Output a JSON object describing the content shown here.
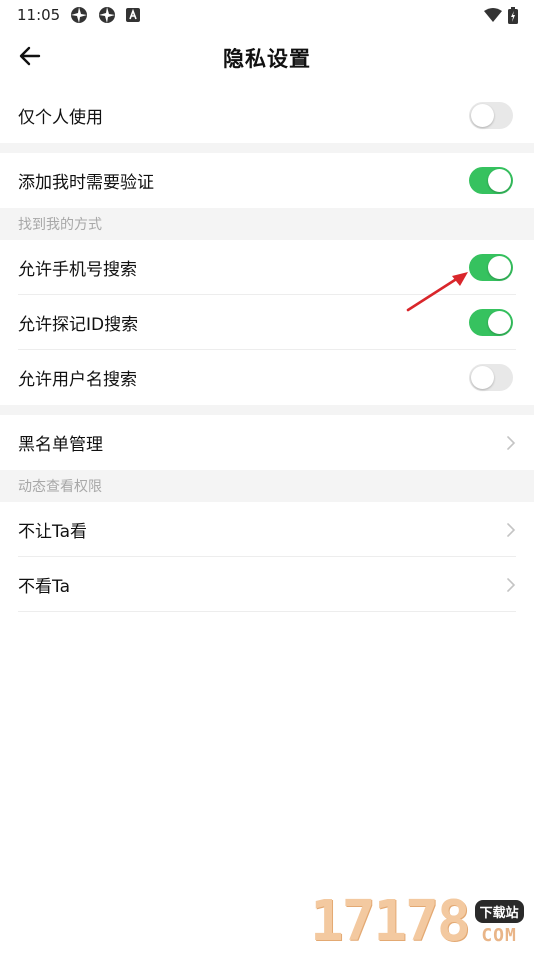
{
  "status_bar": {
    "time": "11:05",
    "left_icons": [
      "aperture-icon",
      "aperture-icon",
      "a-letter-icon"
    ],
    "right_icons": [
      "wifi-icon",
      "battery-charging-icon"
    ]
  },
  "header": {
    "title": "隐私设置",
    "back_icon": "arrow-left-icon"
  },
  "rows": {
    "personal_only": {
      "label": "仅个人使用",
      "enabled": false
    },
    "verify_add": {
      "label": "添加我时需要验证",
      "enabled": true
    },
    "find_section": "找到我的方式",
    "phone_search": {
      "label": "允许手机号搜索",
      "enabled": true
    },
    "tanji_id_search": {
      "label": "允许探记ID搜索",
      "enabled": true
    },
    "username_search": {
      "label": "允许用户名搜索",
      "enabled": false
    },
    "blacklist": {
      "label": "黑名单管理"
    },
    "moments_section": "动态查看权限",
    "hide_from": {
      "label": "不让Ta看"
    },
    "dont_see": {
      "label": "不看Ta"
    }
  },
  "watermark": {
    "digits": "17178",
    "tag": "下载站",
    "suffix": "COM"
  },
  "colors": {
    "toggle_on": "#36c25f",
    "toggle_off": "#e8e8e8",
    "section_bg": "#f4f4f4",
    "section_text": "#a8a8a8",
    "annotation_arrow": "#d9262b"
  }
}
